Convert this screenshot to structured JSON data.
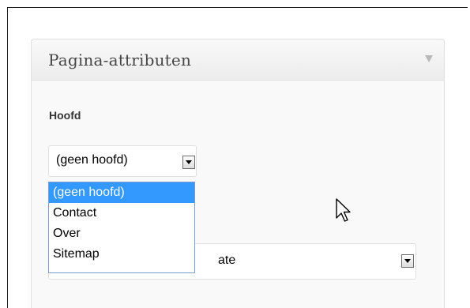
{
  "metabox": {
    "title": "Pagina-attributen",
    "collapse_icon": "triangle-down-icon"
  },
  "parent": {
    "label": "Hoofd",
    "selected": "(geen hoofd)",
    "options": [
      "(geen hoofd)",
      "Contact",
      "Over",
      "Sitemap"
    ],
    "highlighted_option": "(geen hoofd)"
  },
  "template": {
    "visible_value": "ate"
  },
  "cursor_icon": "mouse-pointer-icon"
}
